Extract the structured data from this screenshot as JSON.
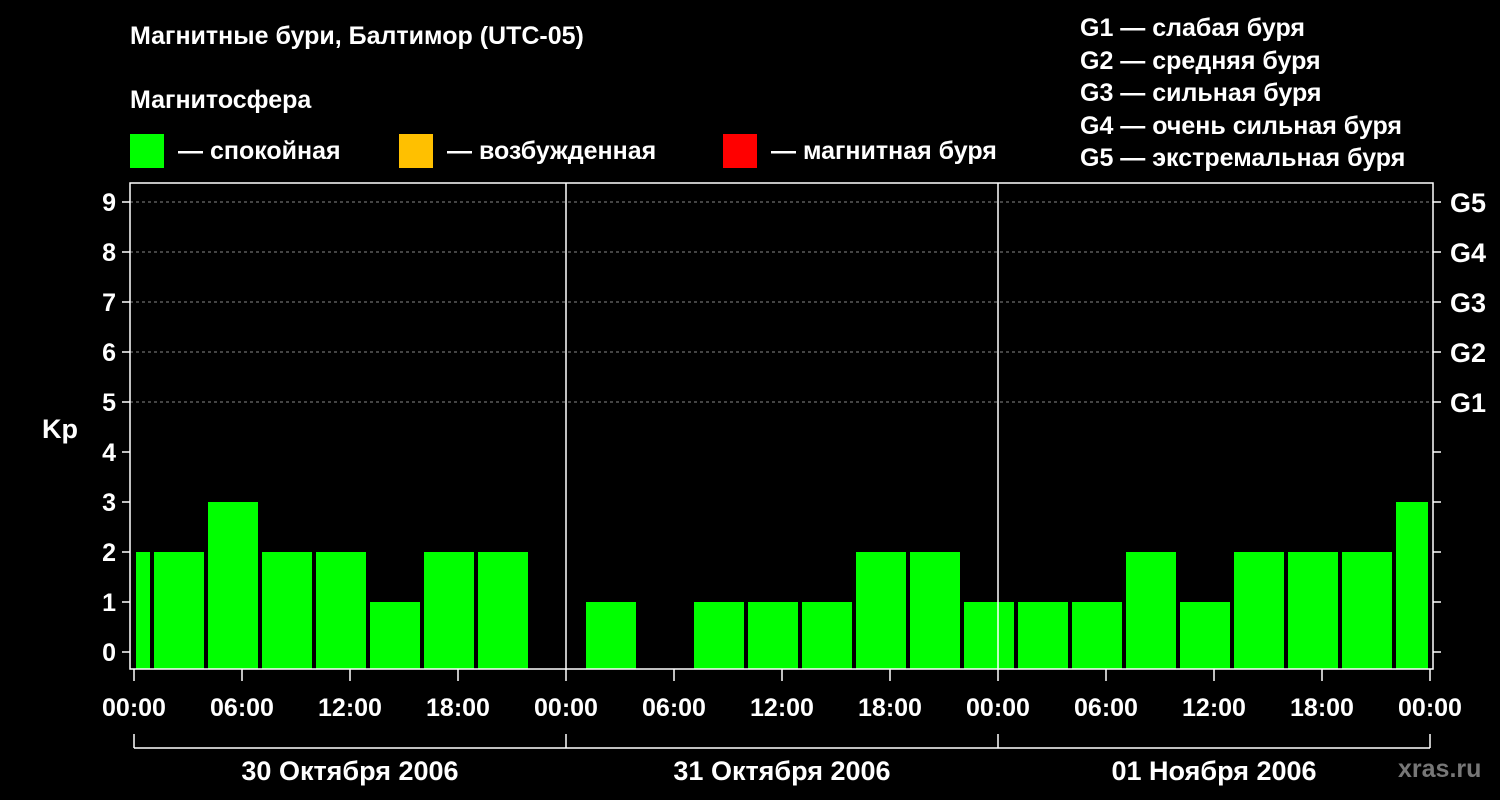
{
  "title": "Магнитные бури, Балтимор (UTC-05)",
  "subtitle": "Магнитосфера",
  "legend": [
    {
      "label": "— спокойная",
      "color": "#00ff00"
    },
    {
      "label": "— возбужденная",
      "color": "#ffc000"
    },
    {
      "label": "— магнитная буря",
      "color": "#ff0000"
    }
  ],
  "storm_legend": [
    "G1 — слабая буря",
    "G2 — средняя буря",
    "G3 — сильная буря",
    "G4 — очень сильная буря",
    "G5 — экстремальная буря"
  ],
  "watermark": "xras.ru",
  "chart_data": {
    "type": "bar",
    "ylabel": "Kp",
    "ylim": [
      0,
      9
    ],
    "yticks": [
      "0",
      "1",
      "2",
      "3",
      "4",
      "5",
      "6",
      "7",
      "8",
      "9"
    ],
    "right_labels": [
      {
        "value": 5,
        "label": "G1"
      },
      {
        "value": 6,
        "label": "G2"
      },
      {
        "value": 7,
        "label": "G3"
      },
      {
        "value": 8,
        "label": "G4"
      },
      {
        "value": 9,
        "label": "G5"
      }
    ],
    "xlim_hours": [
      0,
      72
    ],
    "xticks": [
      {
        "hour": 0,
        "label": "00:00"
      },
      {
        "hour": 6,
        "label": "06:00"
      },
      {
        "hour": 12,
        "label": "12:00"
      },
      {
        "hour": 18,
        "label": "18:00"
      },
      {
        "hour": 24,
        "label": "00:00"
      },
      {
        "hour": 30,
        "label": "06:00"
      },
      {
        "hour": 36,
        "label": "12:00"
      },
      {
        "hour": 42,
        "label": "18:00"
      },
      {
        "hour": 48,
        "label": "00:00"
      },
      {
        "hour": 54,
        "label": "06:00"
      },
      {
        "hour": 60,
        "label": "12:00"
      },
      {
        "hour": 66,
        "label": "18:00"
      },
      {
        "hour": 72,
        "label": "00:00"
      }
    ],
    "days": [
      "30 Октября 2006",
      "31 Октября 2006",
      "01 Ноября 2006"
    ],
    "bar_color": "#00ff00",
    "bars": [
      {
        "start": 0,
        "end": 1,
        "value": 2
      },
      {
        "start": 1,
        "end": 4,
        "value": 2
      },
      {
        "start": 4,
        "end": 7,
        "value": 3
      },
      {
        "start": 7,
        "end": 10,
        "value": 2
      },
      {
        "start": 10,
        "end": 13,
        "value": 2
      },
      {
        "start": 13,
        "end": 16,
        "value": 1
      },
      {
        "start": 16,
        "end": 19,
        "value": 2
      },
      {
        "start": 19,
        "end": 22,
        "value": 2
      },
      {
        "start": 22,
        "end": 25,
        "value": 0
      },
      {
        "start": 25,
        "end": 28,
        "value": 1
      },
      {
        "start": 28,
        "end": 31,
        "value": 0
      },
      {
        "start": 31,
        "end": 34,
        "value": 1
      },
      {
        "start": 34,
        "end": 37,
        "value": 1
      },
      {
        "start": 37,
        "end": 40,
        "value": 1
      },
      {
        "start": 40,
        "end": 43,
        "value": 2
      },
      {
        "start": 43,
        "end": 46,
        "value": 2
      },
      {
        "start": 46,
        "end": 49,
        "value": 1
      },
      {
        "start": 49,
        "end": 52,
        "value": 1
      },
      {
        "start": 52,
        "end": 55,
        "value": 1
      },
      {
        "start": 55,
        "end": 58,
        "value": 2
      },
      {
        "start": 58,
        "end": 61,
        "value": 1
      },
      {
        "start": 61,
        "end": 64,
        "value": 2
      },
      {
        "start": 64,
        "end": 67,
        "value": 2
      },
      {
        "start": 67,
        "end": 70,
        "value": 2
      },
      {
        "start": 70,
        "end": 72,
        "value": 3
      }
    ]
  }
}
